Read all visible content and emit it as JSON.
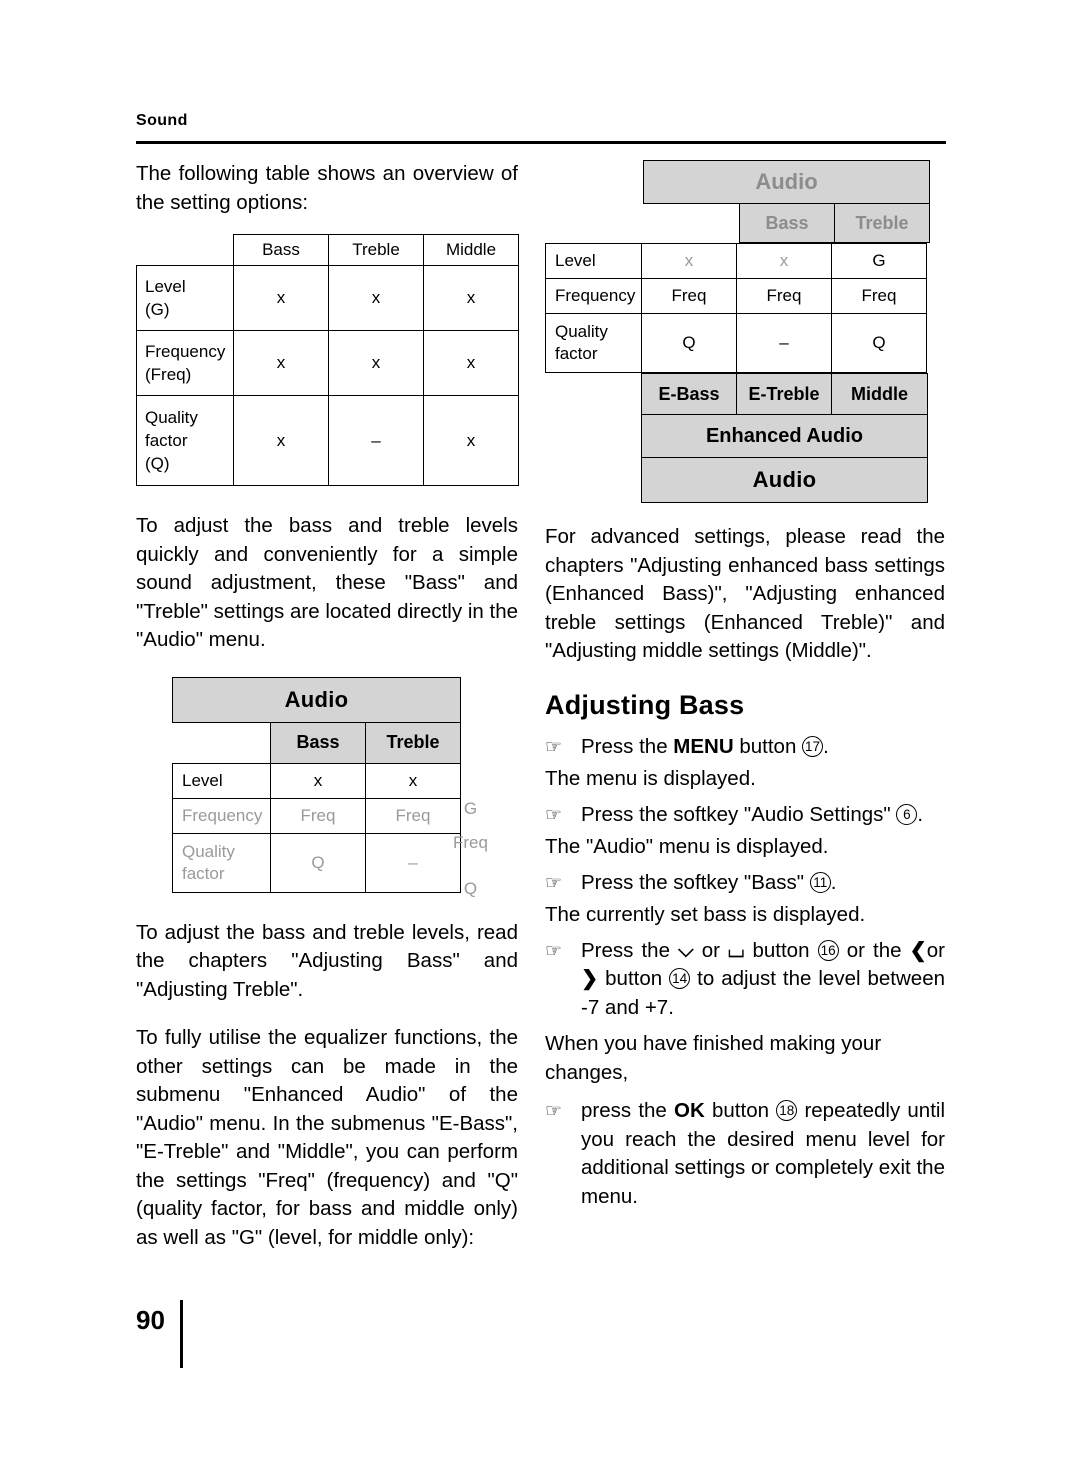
{
  "header": {
    "chapter": "Sound"
  },
  "left": {
    "intro": "The following table shows an overview of the setting options:",
    "overview_table": {
      "columns": [
        "",
        "Bass",
        "Treble",
        "Middle"
      ],
      "rows": [
        {
          "label": "Level\n(G)",
          "values": [
            "x",
            "x",
            "x"
          ]
        },
        {
          "label": "Frequency\n(Freq)",
          "values": [
            "x",
            "x",
            "x"
          ]
        },
        {
          "label": "Quality\nfactor\n(Q)",
          "values": [
            "x",
            "–",
            "x"
          ]
        }
      ]
    },
    "para_quick": "To adjust the bass and treble levels quickly and conveniently for a simple sound adjustment, these \"Bass\" and \"Treble\" settings are located directly in the \"Audio\" menu.",
    "audio_screen": {
      "title": "Audio",
      "col_headers": [
        "Bass",
        "Treble"
      ],
      "rows": [
        {
          "label": "Level",
          "values": [
            "x",
            "x",
            "G"
          ]
        },
        {
          "label": "Frequency",
          "values": [
            "Freq",
            "Freq",
            "Freq"
          ]
        },
        {
          "label": "Quality\nfactor",
          "values": [
            "Q",
            "–",
            "Q"
          ]
        }
      ]
    },
    "para_read": "To adjust the bass and treble levels, read the chapters \"Adjusting Bass\" and \"Adjusting Treble\".",
    "para_equalizer": "To fully utilise the equalizer functions, the other settings can be made in the submenu \"Enhanced Audio\" of the \"Audio\" menu. In the submenus \"E-Bass\", \"E-Treble\" and \"Middle\", you can perform the settings \"Freq\" (frequency) and \"Q\" (quality factor, for bass and middle only) as well as \"G\" (level, for middle only):"
  },
  "right": {
    "enhanced_screen": {
      "title": "Audio",
      "col_headers": [
        "Bass",
        "Treble"
      ],
      "rows": [
        {
          "label": "Level",
          "values": [
            "x",
            "x",
            "G"
          ]
        },
        {
          "label": "Frequency",
          "values": [
            "Freq",
            "Freq",
            "Freq"
          ]
        },
        {
          "label": "Quality\nfactor",
          "values": [
            "Q",
            "–",
            "Q"
          ]
        }
      ],
      "bottom_headers": [
        "E-Bass",
        "E-Treble",
        "Middle"
      ],
      "enhanced_label": "Enhanced Audio",
      "footer_label": "Audio"
    },
    "para_advanced": "For advanced settings, please read the chapters \"Adjusting enhanced bass settings (Enhanced Bass)\", \"Adjusting enhanced treble settings (Enhanced Treble)\" and \"Adjusting middle settings (Middle)\".",
    "section_title": "Adjusting Bass",
    "steps": [
      {
        "pre": "Press the ",
        "bold": "MENU",
        "post": " button ",
        "ref": "17",
        "tail": ".",
        "note": "The menu is displayed."
      },
      {
        "pre": "Press the softkey \"Audio Settings\" ",
        "bold": "",
        "post": "",
        "ref": "6",
        "tail": ".",
        "note": "The \"Audio\" menu is displayed."
      },
      {
        "pre": "Press the softkey \"Bass\" ",
        "bold": "",
        "post": "",
        "ref": "11",
        "tail": ".",
        "note": "The currently set bass is displayed."
      }
    ],
    "step_adjust": {
      "t1": "Press the ",
      "icon1": "down-arrow-icon",
      "t2": " or ",
      "icon2": "up-arrow-icon",
      "t3": " button ",
      "ref1": "16",
      "t4": " or the ",
      "icon3": "left-arrow-icon",
      "t5": "or ",
      "icon4": "right-arrow-icon",
      "t6": " button ",
      "ref2": "14",
      "t7": " to adjust the level between -7 and +7."
    },
    "para_finished": "When you have finished making your changes,",
    "step_ok": {
      "pre": "press the ",
      "bold": "OK",
      "mid": " button ",
      "ref": "18",
      "post": " repeatedly until you reach the desired menu level for additional settings or completely exit the menu."
    }
  },
  "footer": {
    "page_number": "90"
  }
}
